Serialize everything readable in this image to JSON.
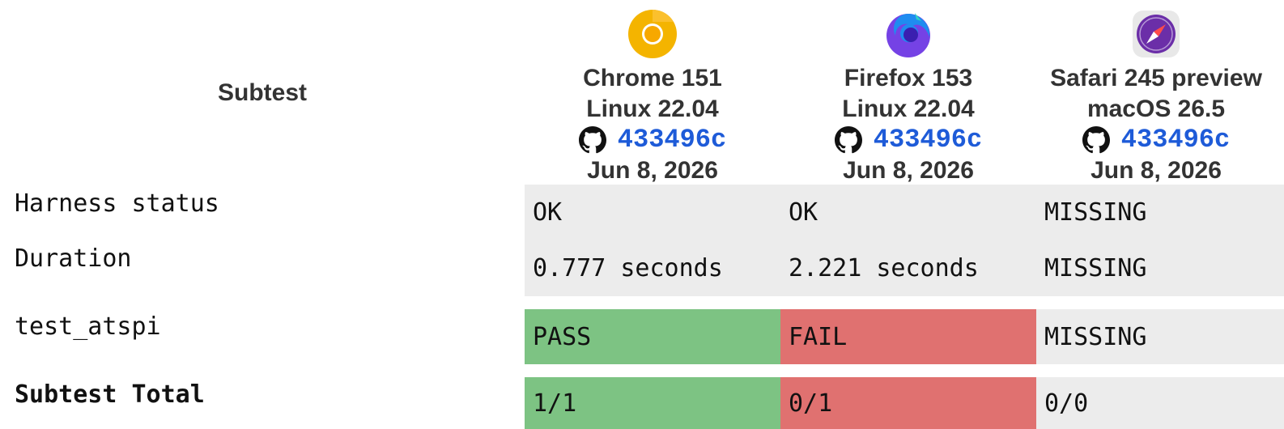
{
  "header": {
    "subtest_label": "Subtest",
    "browsers": [
      {
        "name": "Chrome 151",
        "os": "Linux 22.04",
        "revision": "433496c",
        "date": "Jun 8, 2026",
        "icon": "chrome-logo-icon"
      },
      {
        "name": "Firefox 153",
        "os": "Linux 22.04",
        "revision": "433496c",
        "date": "Jun 8, 2026",
        "icon": "firefox-logo-icon"
      },
      {
        "name": "Safari 245 preview",
        "os": "macOS 26.5",
        "revision": "433496c",
        "date": "Jun 8, 2026",
        "icon": "safari-logo-icon"
      }
    ]
  },
  "rows": [
    {
      "label": "Harness status",
      "cells": [
        "OK",
        "OK",
        "MISSING"
      ],
      "status": [
        "neutral",
        "neutral",
        "neutral"
      ]
    },
    {
      "label": "Duration",
      "cells": [
        "0.777 seconds",
        "2.221 seconds",
        "MISSING"
      ],
      "status": [
        "neutral",
        "neutral",
        "neutral"
      ]
    },
    {
      "label": "test_atspi",
      "cells": [
        "PASS",
        "FAIL",
        "MISSING"
      ],
      "status": [
        "pass",
        "fail",
        "neutral"
      ]
    },
    {
      "label": "Subtest Total",
      "cells": [
        "1/1",
        "0/1",
        "0/0"
      ],
      "status": [
        "pass",
        "fail",
        "neutral"
      ]
    }
  ],
  "colors": {
    "pass": "#7dc383",
    "fail": "#e07170",
    "neutral": "#ececec",
    "link": "#1e5bd8"
  }
}
